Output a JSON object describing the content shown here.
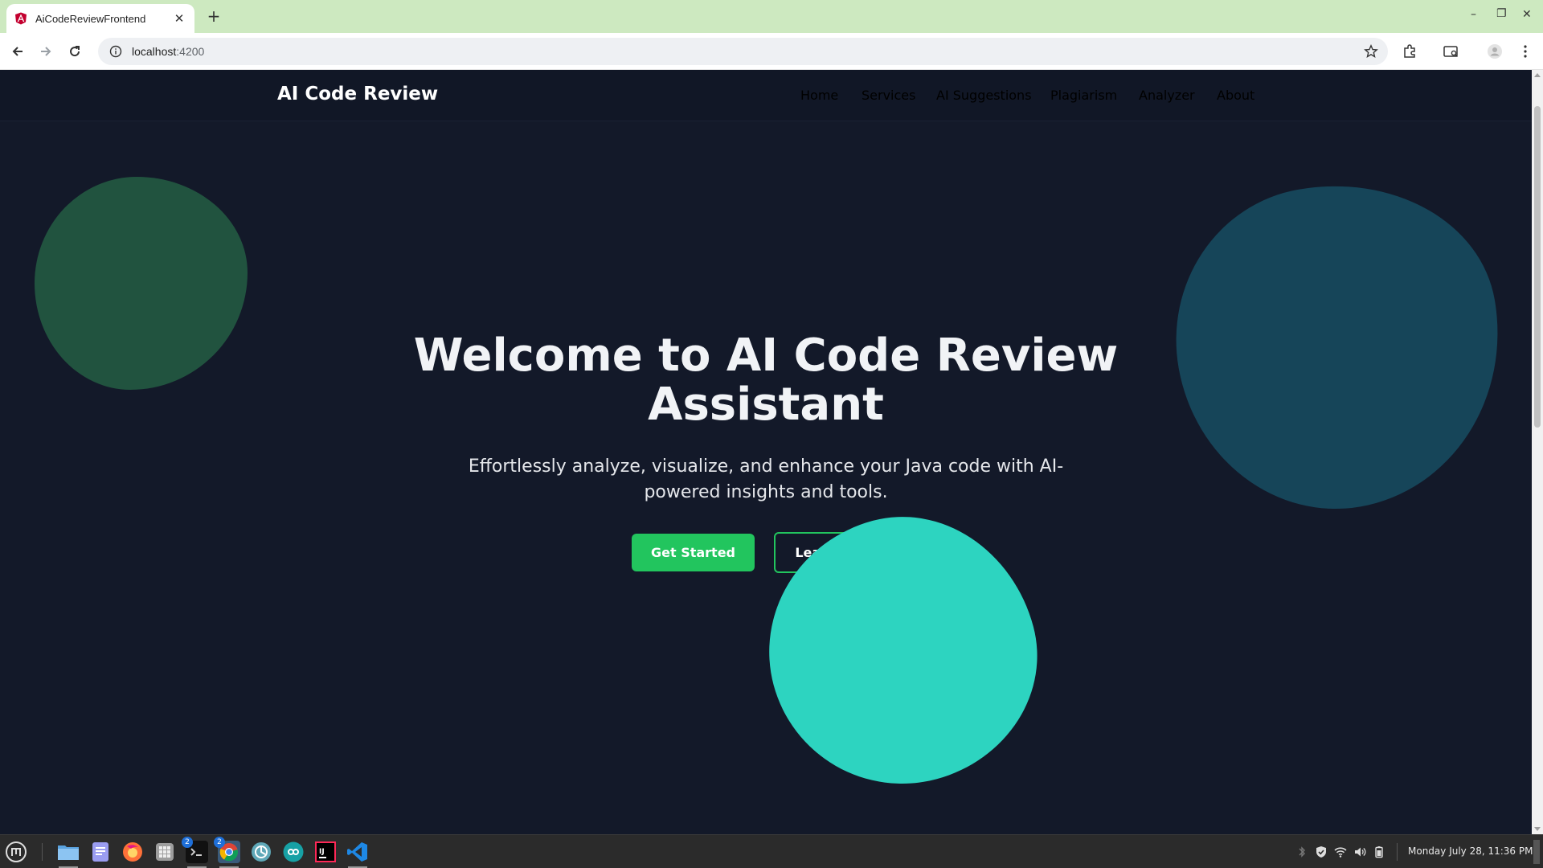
{
  "browser": {
    "tab_title": "AiCodeReviewFrontend",
    "url_host": "localhost",
    "url_port": ":4200"
  },
  "site": {
    "brand": "AI Code Review",
    "nav": [
      "Home",
      "Services",
      "AI Suggestions",
      "Plagiarism",
      "Analyzer",
      "About"
    ]
  },
  "hero": {
    "title_line1": "Welcome to AI Code Review",
    "title_line2": "Assistant",
    "subtitle_line1": "Effortlessly analyze, visualize, and enhance your Java code with AI-",
    "subtitle_line2": "powered insights and tools.",
    "primary_button": "Get Started",
    "secondary_button": "Learn More"
  },
  "colors": {
    "background": "#131929",
    "accent": "#22c55e",
    "blob_green": "#21533f",
    "blob_blue": "#164559",
    "blob_teal": "#2dd4c0"
  },
  "taskbar": {
    "badges": {
      "terminal": "2",
      "chrome": "2"
    },
    "clock": "Monday July 28, 11:36 PM"
  }
}
